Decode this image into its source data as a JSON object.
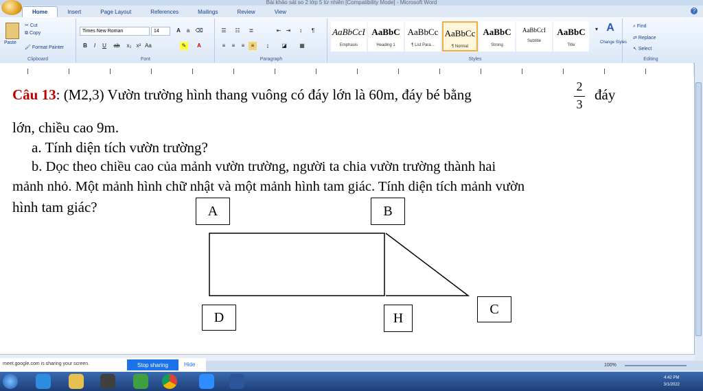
{
  "window": {
    "title": "Bài khảo sát so 2 lớp 5 từ nhiên [Compatibility Mode] - Microsoft Word"
  },
  "tabs": [
    "Home",
    "Insert",
    "Page Layout",
    "References",
    "Mailings",
    "Review",
    "View"
  ],
  "clipboard": {
    "paste": "Paste",
    "cut": "Cut",
    "copy": "Copy",
    "format_painter": "Format Painter",
    "label": "Clipboard"
  },
  "font": {
    "name": "Times New Roman",
    "size": "14",
    "label": "Font"
  },
  "paragraph": {
    "label": "Paragraph"
  },
  "styles": {
    "label": "Styles",
    "items": [
      {
        "sample": "AaBbCcI",
        "name": "Emphasis"
      },
      {
        "sample": "AaBbC",
        "name": "Heading 1"
      },
      {
        "sample": "AaBbCc",
        "name": "¶ List Para..."
      },
      {
        "sample": "AaBbCc",
        "name": "¶ Normal"
      },
      {
        "sample": "AaBbC",
        "name": "Strong"
      },
      {
        "sample": "AaBbCcI",
        "name": "Subtitle"
      },
      {
        "sample": "AaBbC",
        "name": "Title"
      }
    ],
    "change": "Change Styles"
  },
  "editing": {
    "find": "Find",
    "replace": "Replace",
    "select": "Select",
    "label": "Editing"
  },
  "doc": {
    "q_label": "Câu 13",
    "line1": ": (M2,3) Vườn trường hình thang vuông có đáy lớn là 60m, đáy bé bằng",
    "frac_num": "2",
    "frac_den": "3",
    "line1_end": "đáy",
    "line2": "lớn, chiều cao 9m.",
    "line3": "a. Tính diện tích vườn trường?",
    "line4": "b. Dọc theo chiều cao của mảnh vườn trường, người ta chia vườn trường thành hai",
    "line5": "mảnh nhỏ. Một mảnh hình chữ nhật và một mảnh hình tam giác. Tính diện tích mảnh vườn",
    "line6": "hình tam giác?",
    "labels": {
      "A": "A",
      "B": "B",
      "C": "C",
      "D": "D",
      "H": "H"
    }
  },
  "status": {
    "zoom": "100%"
  },
  "share": {
    "text": "meet.google.com is sharing your screen.",
    "stop": "Stop sharing",
    "hide": "Hide"
  },
  "clock": {
    "time": "4:42 PM",
    "date": "3/1/2022"
  }
}
